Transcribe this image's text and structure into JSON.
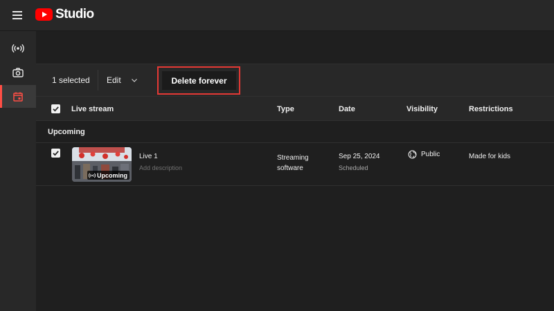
{
  "app": {
    "name": "Studio"
  },
  "icons": {
    "menu": "hamburger-icon",
    "live": "live-broadcast-icon",
    "camera": "camera-icon",
    "calendar": "calendar-icon",
    "dropdown": "chevron-down-icon",
    "check": "checkmark-icon",
    "globe": "globe-icon"
  },
  "colors": {
    "brand": "#ff0000",
    "accent_active": "#ff4e45",
    "highlight_box": "#e53935"
  },
  "action_bar": {
    "selected_count": "1 selected",
    "edit_label": "Edit",
    "delete_label": "Delete forever"
  },
  "table": {
    "columns": [
      "Live stream",
      "Type",
      "Date",
      "Visibility",
      "Restrictions"
    ],
    "header_checkbox_checked": true
  },
  "section": {
    "label": "Upcoming"
  },
  "rows": [
    {
      "checked": true,
      "thumbnail_badge": "Upcoming",
      "title": "Live 1",
      "description": "Add description",
      "type": "Streaming software",
      "date": "Sep 25, 2024",
      "date_status": "Scheduled",
      "visibility": "Public",
      "restrictions": "Made for kids"
    }
  ]
}
